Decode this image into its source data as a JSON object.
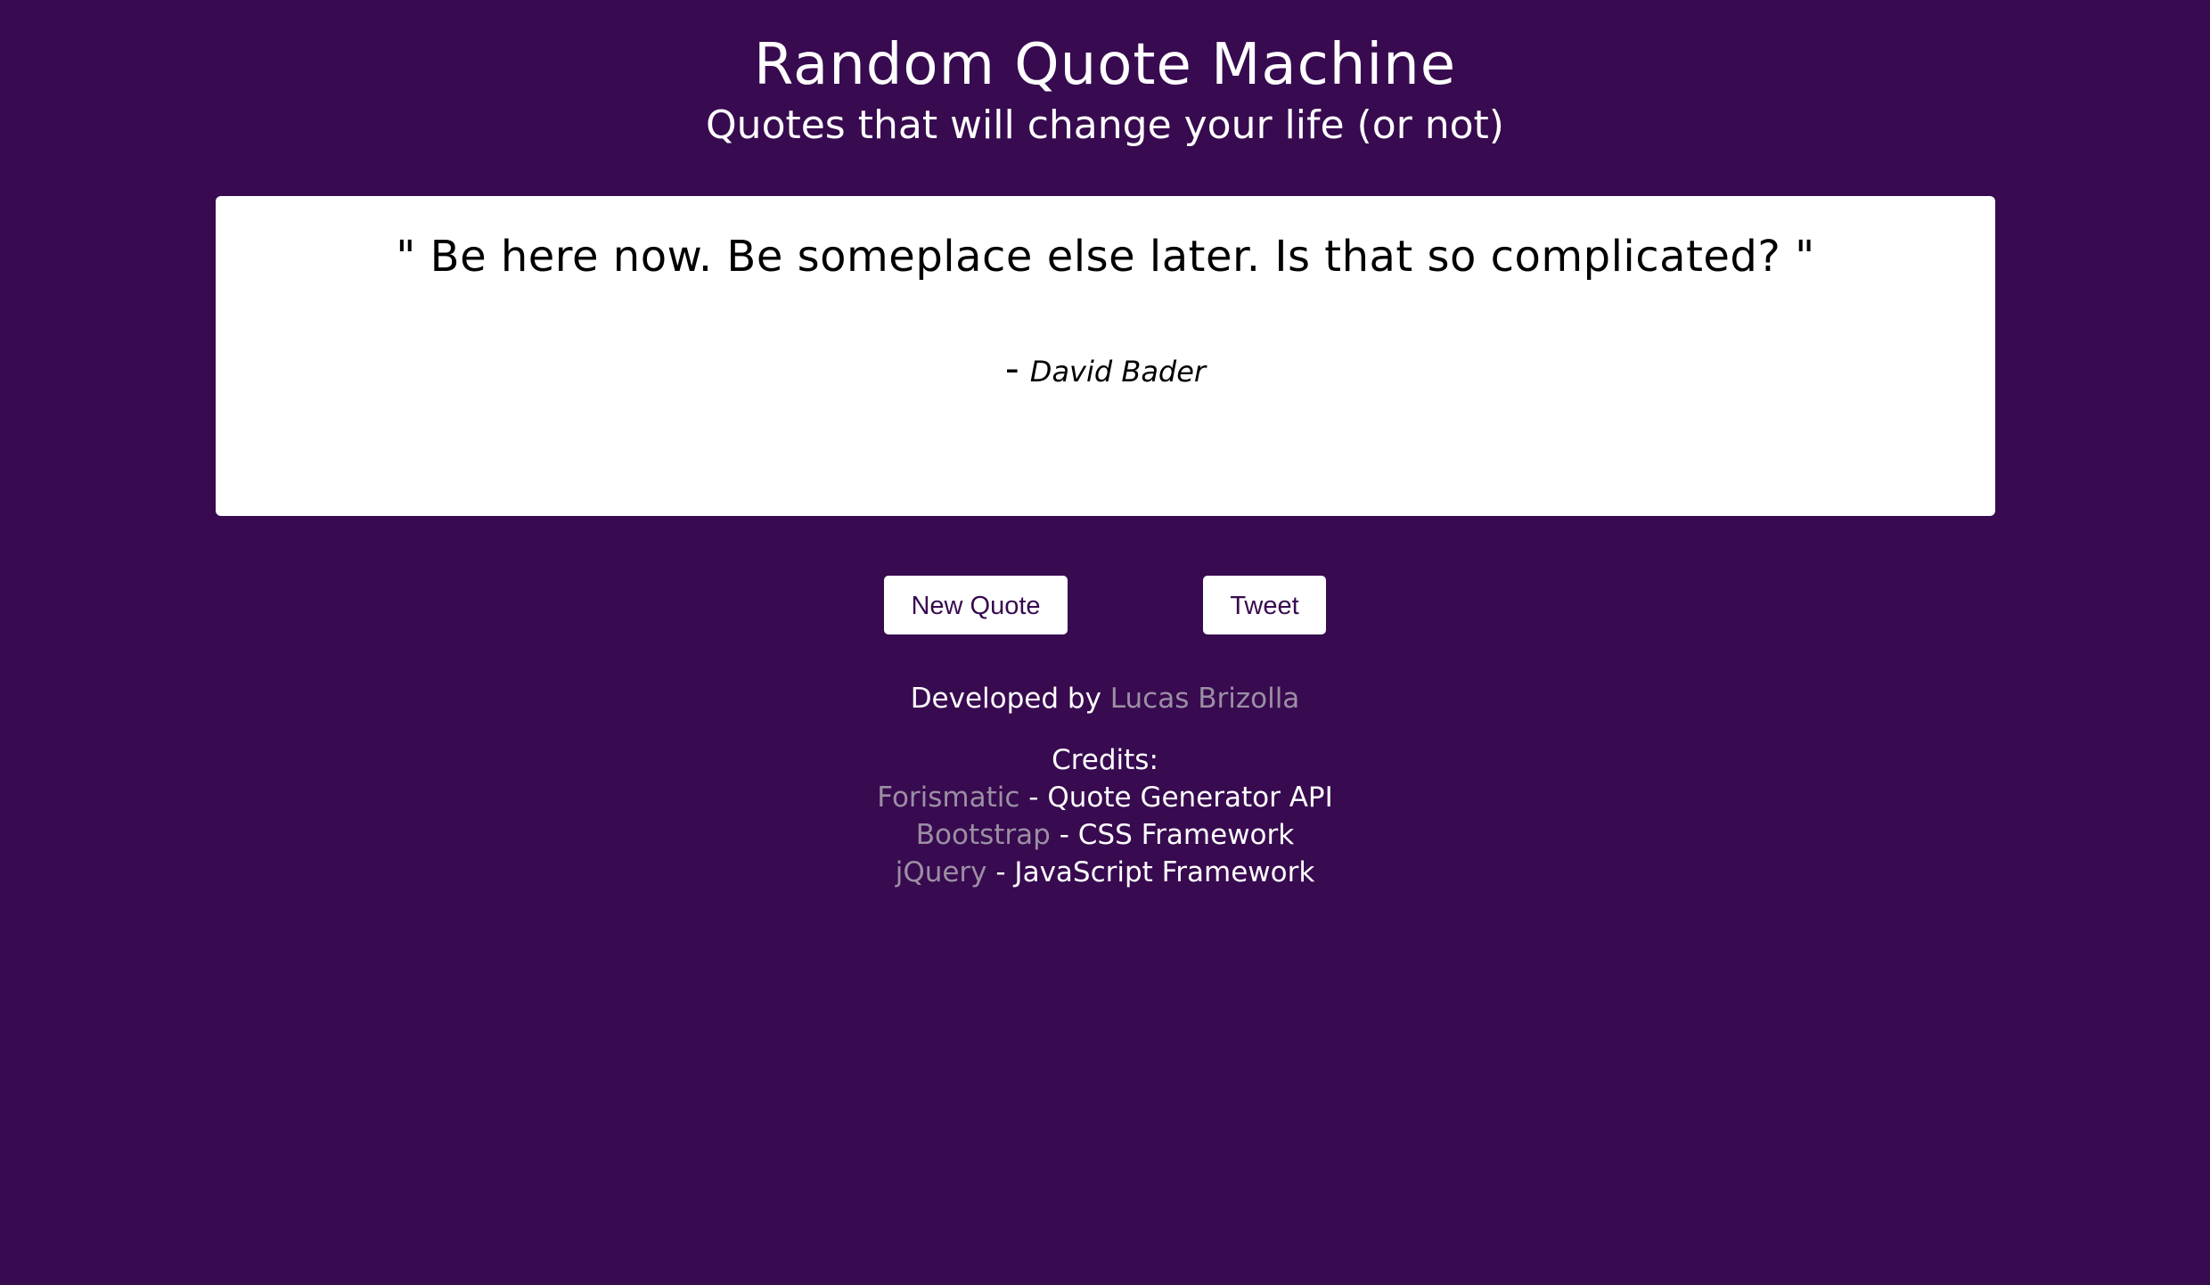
{
  "header": {
    "title": "Random Quote Machine",
    "subtitle": "Quotes that will change your life (or not)"
  },
  "quote": {
    "text": "\" Be here now. Be someplace else later. Is that so complicated? \"",
    "dash": "-",
    "author": "David Bader"
  },
  "buttons": {
    "new_quote": "New Quote",
    "tweet": "Tweet"
  },
  "footer": {
    "developed_by": "Developed by ",
    "developer_name": "Lucas Brizolla",
    "credits_label": "Credits:",
    "credits": [
      {
        "name": "Forismatic",
        "description": " - Quote Generator API"
      },
      {
        "name": "Bootstrap",
        "description": " - CSS Framework"
      },
      {
        "name": "jQuery",
        "description": " - JavaScript Framework"
      }
    ]
  },
  "colors": {
    "background": "#380a50",
    "card": "#ffffff",
    "link": "#9b8fa3",
    "button_text": "#380a50"
  }
}
